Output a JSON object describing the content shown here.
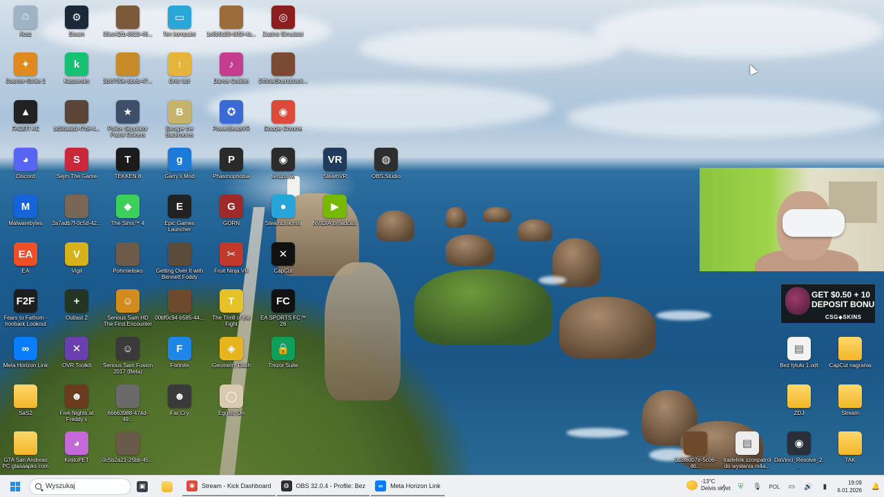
{
  "desktop_icons": [
    {
      "label": "Kosz",
      "color": "#9fb3c7",
      "glyph": "♲"
    },
    {
      "label": "Steam",
      "color": "#1b2838",
      "glyph": "⚙"
    },
    {
      "label": "05ec42fb-8819-46...",
      "color": "#7a5a3a",
      "glyph": ""
    },
    {
      "label": "Ten komputer",
      "color": "#2aa6d8",
      "glyph": "▭"
    },
    {
      "label": "1e8b9d30-809f-4a...",
      "color": "#9c6b3a",
      "glyph": ""
    },
    {
      "label": "Casino Simulator",
      "color": "#8b1e1e",
      "glyph": "◎"
    },
    {
      "label": "Counter-Strike 2",
      "color": "#e08a1e",
      "glyph": "✦"
    },
    {
      "label": "Kaspersky",
      "color": "#16c172",
      "glyph": "k"
    },
    {
      "label": "3bfc700e-bbeb-47...",
      "color": "#c98b2a",
      "glyph": ""
    },
    {
      "label": "Only Up!",
      "color": "#e4b53a",
      "glyph": "↑"
    },
    {
      "label": "Dance Collider",
      "color": "#c43d8f",
      "glyph": "♪"
    },
    {
      "label": "OfficialSoundtrack...",
      "color": "#7b4a32",
      "glyph": ""
    },
    {
      "label": "FACEIT AC",
      "color": "#222222",
      "glyph": "▲"
    },
    {
      "label": "bd3daab1-f7c8-4...",
      "color": "#5b4538",
      "glyph": ""
    },
    {
      "label": "Police Simulator Patrol Officers",
      "color": "#3e4f6a",
      "glyph": "★"
    },
    {
      "label": "Escape the Backrooms",
      "color": "#c6b26a",
      "glyph": "B"
    },
    {
      "label": "PowerBeatsVR",
      "color": "#3a6ad3",
      "glyph": "✪"
    },
    {
      "label": "Google Chrome",
      "color": "#dd4a3a",
      "glyph": "◉"
    },
    {
      "label": "Discord",
      "color": "#5865f2",
      "glyph": "◕"
    },
    {
      "label": "Sejm The Game",
      "color": "#c8283a",
      "glyph": "S"
    },
    {
      "label": "TEKKEN 8",
      "color": "#1b1b1b",
      "glyph": "T"
    },
    {
      "label": "Garry's Mod",
      "color": "#1d7ad8",
      "glyph": "g"
    },
    {
      "label": "Phasmophobia",
      "color": "#2a2a2a",
      "glyph": "P"
    },
    {
      "label": "setup.exe",
      "color": "#2b2b2b",
      "glyph": "◉"
    },
    {
      "label": "SteamVR",
      "color": "#1f3c5e",
      "glyph": "VR"
    },
    {
      "label": "OBS Studio",
      "color": "#2e2e2e",
      "glyph": "◍"
    },
    {
      "label": "Malwarebytes",
      "color": "#1664d9",
      "glyph": "M"
    },
    {
      "label": "2a7adb7f-0c5d-42...",
      "color": "#7a6655",
      "glyph": ""
    },
    {
      "label": "The Sims™ 4",
      "color": "#3ccf5a",
      "glyph": "◆"
    },
    {
      "label": "Epic Games Launcher",
      "color": "#222222",
      "glyph": "E"
    },
    {
      "label": "GORN",
      "color": "#9e2a2a",
      "glyph": "G"
    },
    {
      "label": "SteamLink.msi",
      "color": "#27a4d8",
      "glyph": "●"
    },
    {
      "label": "NVIDIA Broadcast",
      "color": "#76b900",
      "glyph": "▶"
    },
    {
      "label": "EA",
      "color": "#ef4f24",
      "glyph": "EA"
    },
    {
      "label": "Vigil",
      "color": "#d7b21b",
      "glyph": "V"
    },
    {
      "label": "Pohmielisko",
      "color": "#6e5a48",
      "glyph": ""
    },
    {
      "label": "Getting Over It with Bennett Foddy",
      "color": "#5b4b3a",
      "glyph": ""
    },
    {
      "label": "Fruit Ninja VR",
      "color": "#c0392b",
      "glyph": "✂"
    },
    {
      "label": "CapCut",
      "color": "#111111",
      "glyph": "✕"
    },
    {
      "label": "Fears to Fathom - Ironbark Lookout",
      "color": "#1d1d1d",
      "glyph": "F2F"
    },
    {
      "label": "Outlast 2",
      "color": "#253524",
      "glyph": "+"
    },
    {
      "label": "Serious Sam HD The First Encounter",
      "color": "#d38b1c",
      "glyph": "☺"
    },
    {
      "label": "00bf0c94-b585-44...",
      "color": "#6d4a2c",
      "glyph": ""
    },
    {
      "label": "The Thrill of the Fight",
      "color": "#e6c229",
      "glyph": "T"
    },
    {
      "label": "EA SPORTS FC™ 26",
      "color": "#111111",
      "glyph": "FC"
    },
    {
      "label": "Meta Horizon Link",
      "color": "#0a7cff",
      "glyph": "∞"
    },
    {
      "label": "OVR Toolkit",
      "color": "#6a3fb0",
      "glyph": "✕"
    },
    {
      "label": "Serious Sam Fusion 2017 (Beta)",
      "color": "#3a3a3a",
      "glyph": "☺"
    },
    {
      "label": "Fortnite",
      "color": "#1e86e6",
      "glyph": "F"
    },
    {
      "label": "Geometry Dash",
      "color": "#e6b41d",
      "glyph": "◈"
    },
    {
      "label": "Trezor Suite",
      "color": "#0f9f5a",
      "glyph": "🔒"
    },
    {
      "label": "SaS2",
      "color": "#f1b62a",
      "glyph": "",
      "folder": true
    },
    {
      "label": "Five Nights at Freddy's",
      "color": "#6a3b1e",
      "glyph": "☻"
    },
    {
      "label": "66663988-474d-49...",
      "color": "#6a6a6a",
      "glyph": ""
    },
    {
      "label": "Far Cry",
      "color": "#3a3a3a",
      "glyph": "☻"
    },
    {
      "label": "Egging On",
      "color": "#d9c9b0",
      "glyph": "◯"
    },
    {
      "label": "GTA San Andreas PC gtasaapks.com",
      "color": "#f1b62a",
      "glyph": "",
      "folder": true
    },
    {
      "label": "KinitoPET",
      "color": "#c46ad8",
      "glyph": "◕"
    },
    {
      "label": "0c5b2a21-25bb-45...",
      "color": "#6a5a4a",
      "glyph": ""
    }
  ],
  "right_icons": [
    {
      "label": "Bez tytułu 1.odt",
      "color": "#f3f3f3",
      "glyph": "▤"
    },
    {
      "label": "CapCut nagrania",
      "color": "#f1b62a",
      "glyph": "",
      "folder": true
    },
    {
      "label": "ZDJ",
      "color": "#f1b62a",
      "glyph": "",
      "folder": true
    },
    {
      "label": "Stream",
      "color": "#f1b62a",
      "glyph": "",
      "folder": true
    },
    {
      "label": "0d3fed07e-5c06-46...",
      "color": "#6d4a2c",
      "glyph": ""
    },
    {
      "label": "tradelink szonpatrol do wysłania m4a...",
      "color": "#ededed",
      "glyph": "▤"
    },
    {
      "label": "DaVinci_Resolve_2...",
      "color": "#2a2f3a",
      "glyph": "◉"
    },
    {
      "label": "TAK",
      "color": "#f1b62a",
      "glyph": "",
      "folder": true
    }
  ],
  "ad": {
    "line1": "GET $0.50 + 10",
    "line2": "DEPOSIT BONU",
    "brand": "CSG◆SKINS"
  },
  "taskbar": {
    "search_placeholder": "Wyszukaj",
    "apps": [
      {
        "label": "Stream - Kick Dashboard",
        "color": "#dd4a3a",
        "glyph": "◉"
      },
      {
        "label": "OBS 32.0.4 - Profile: Bez",
        "color": "#2e2e2e",
        "glyph": "◍"
      },
      {
        "label": "Meta Horizon Link",
        "color": "#0a7cff",
        "glyph": "∞"
      }
    ],
    "weather_temp": "-13°C",
    "weather_desc": "Delvis skyet",
    "language": "POL",
    "time": "19:09",
    "date": "6.01.2026"
  }
}
